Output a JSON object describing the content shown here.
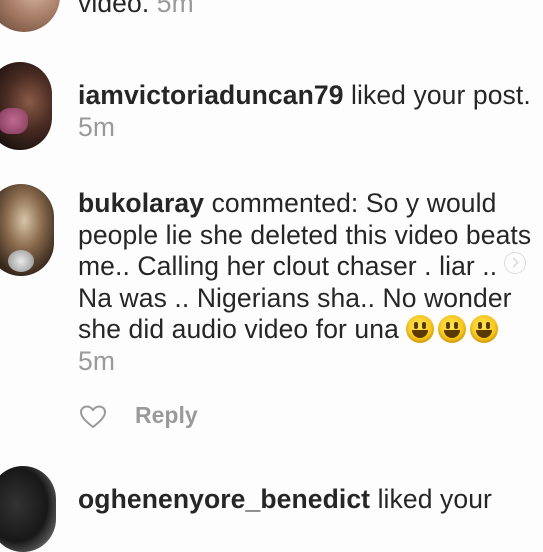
{
  "notifications": [
    {
      "avatar": "avatar-partial",
      "text_tail": "video.",
      "time": "5m"
    },
    {
      "username": "iamvictoriaduncan79",
      "action": "liked your post.",
      "time": "5m"
    },
    {
      "username": "bukolaray",
      "action": "commented: So y would people lie she deleted this video beats me.. Calling her clout chaser . liar .. Na was .. Nigerians sha.. No wonder she did audio video for una",
      "emojis": [
        "grinning-face",
        "grinning-face",
        "grinning-face"
      ],
      "time": "5m",
      "reply_label": "Reply"
    },
    {
      "username": "oghenenyore_benedict",
      "action": "liked your"
    }
  ]
}
